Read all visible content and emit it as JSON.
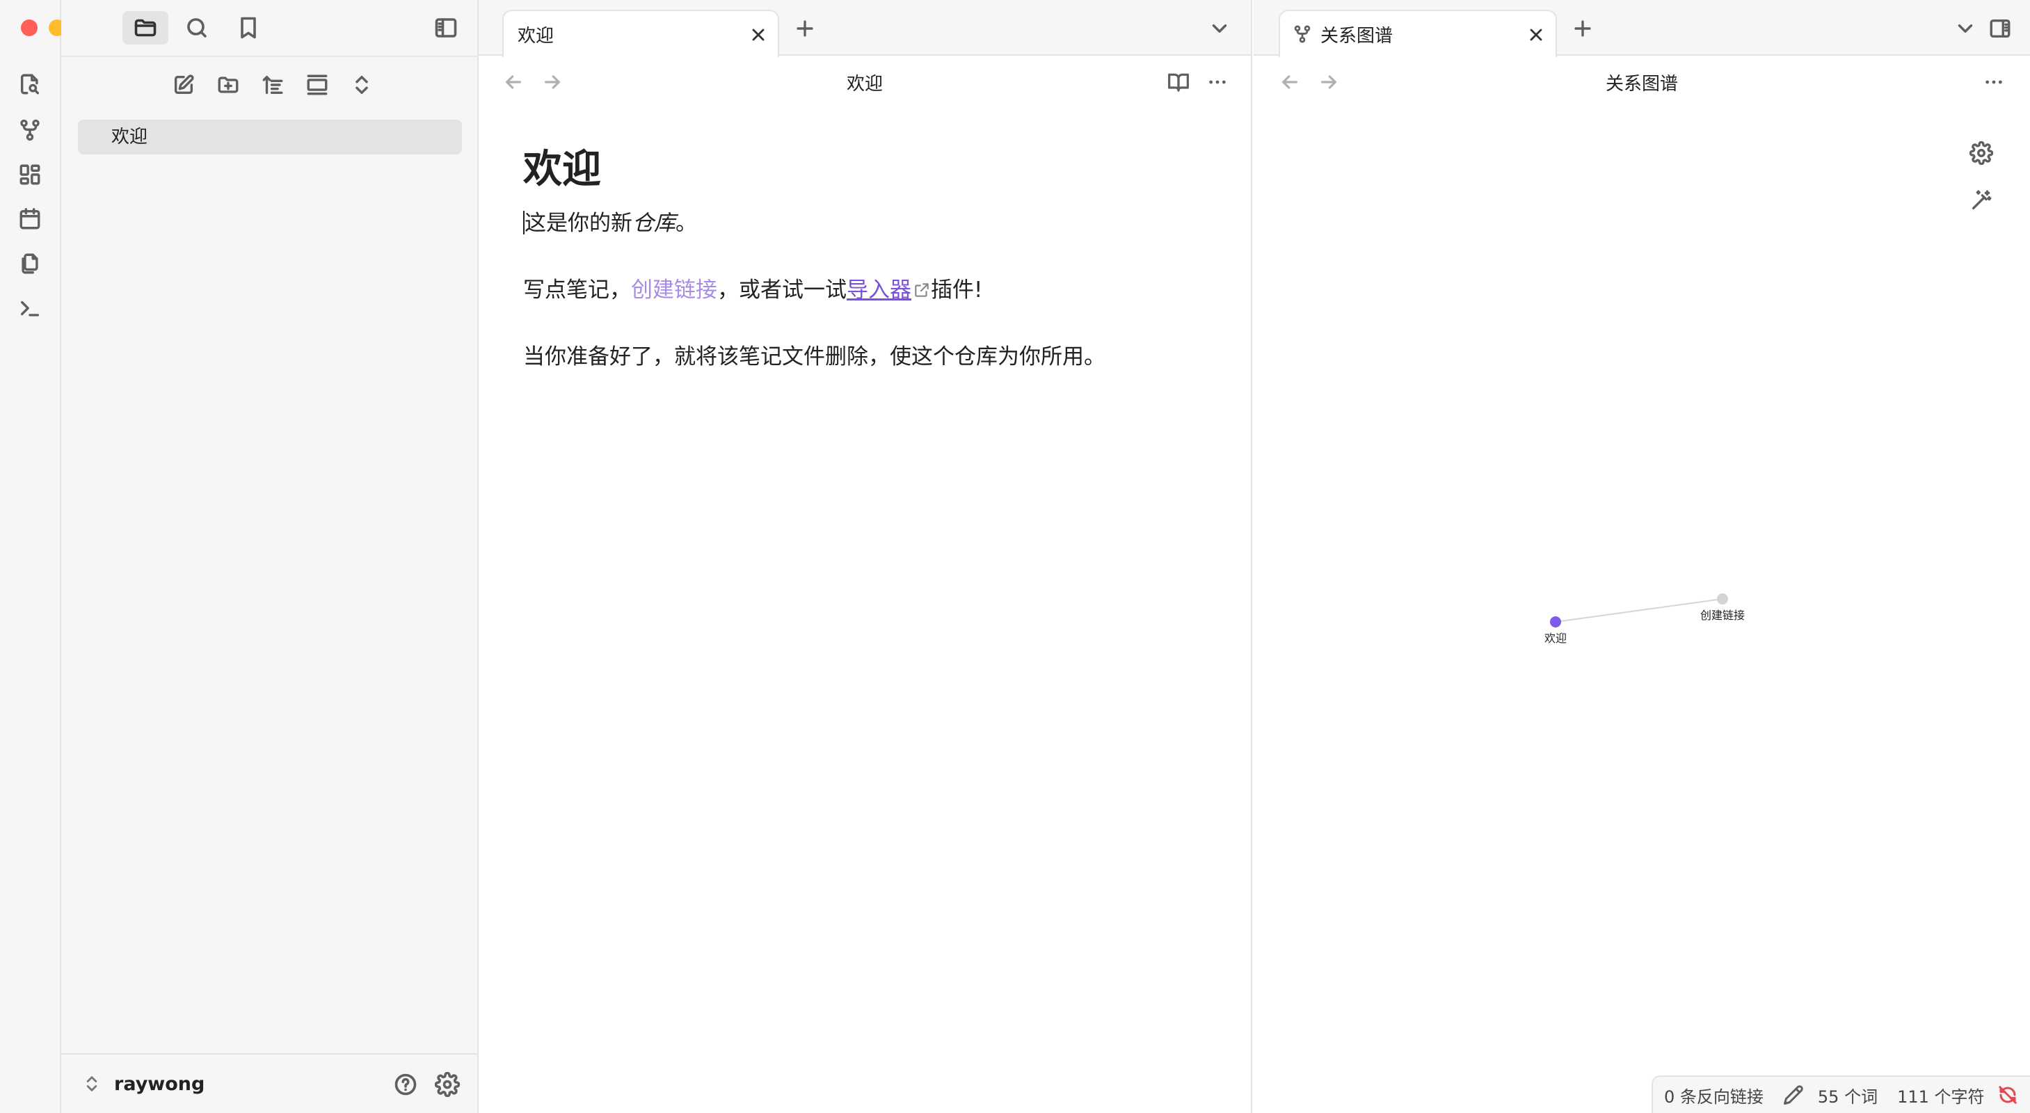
{
  "app": {
    "vault_name": "raywong"
  },
  "sidebar": {
    "files": [
      {
        "name": "欢迎",
        "selected": true
      }
    ]
  },
  "left_pane": {
    "tab_title": "欢迎",
    "header_title": "欢迎",
    "note": {
      "heading": "欢迎",
      "p1_prefix": "这是你的新",
      "p1_em": "仓库",
      "p1_suffix": "。",
      "p2_prefix": "写点笔记，",
      "p2_internal_link": "创建链接",
      "p2_middle": "，或者试一试",
      "p2_external_link": "导入器",
      "p2_suffix": "插件!",
      "p3": "当你准备好了，就将该笔记文件删除，使这个仓库为你所用。"
    }
  },
  "right_pane": {
    "tab_title": "关系图谱",
    "header_title": "关系图谱",
    "graph": {
      "nodes": [
        {
          "id": "welcome",
          "label": "欢迎",
          "color": "#7c5ce8"
        },
        {
          "id": "create-link",
          "label": "创建链接",
          "color": "#d4d4d4"
        }
      ],
      "edges": [
        {
          "from": "welcome",
          "to": "create-link"
        }
      ]
    }
  },
  "status_bar": {
    "backlinks": "0 条反向链接",
    "words": "55 个词",
    "chars": "111 个字符"
  },
  "colors": {
    "accent": "#7c4fdf",
    "internal_link": "#a88be8",
    "sync_error": "#e5484d"
  }
}
